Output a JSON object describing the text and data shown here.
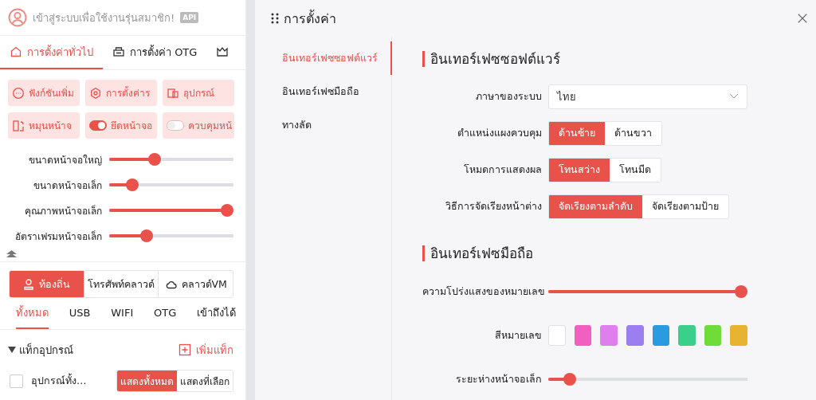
{
  "account": {
    "prompt": "เข้าสู่ระบบเพื่อใช้งานรุ่นสมาชิก!",
    "badge": "API"
  },
  "main_tabs": [
    {
      "label": "การตั้งค่าทั่วไป",
      "selected": true
    },
    {
      "label": "การตั้งค่า OTG",
      "selected": false
    },
    {
      "selected": false
    }
  ],
  "quick_actions": [
    {
      "kind": "button",
      "label": "ฟังก์ชันเพิ่ม"
    },
    {
      "kind": "button",
      "label": "การตั้งค่าร"
    },
    {
      "kind": "button",
      "label": "อุปกรณ์"
    },
    {
      "kind": "button",
      "label": "หมุนหน้าจ"
    },
    {
      "kind": "toggle",
      "on": true,
      "label": "ยึดหน้าจอ"
    },
    {
      "kind": "toggle",
      "on": false,
      "label": "ควบคุมหน้"
    }
  ],
  "sliders": [
    {
      "label": "ขนาดหน้าจอใหญ่",
      "level": 0.35
    },
    {
      "label": "ขนาดหน้าจอเล็ก",
      "level": 0.15
    },
    {
      "label": "คุณภาพหน้าจอเล็ก",
      "level": 1
    },
    {
      "label": "อัตราเฟรมหน้าจอเล็ก",
      "level": 0.28
    }
  ],
  "source_switch": [
    {
      "label": "ท้องถิ่น",
      "selected": true
    },
    {
      "label": "โทรศัพท์คลาวด์",
      "selected": false
    },
    {
      "label": "คลาวด์VM",
      "selected": false
    }
  ],
  "filter_tabs": [
    {
      "label": "ทั้งหมด",
      "selected": true
    },
    {
      "label": "USB",
      "selected": false
    },
    {
      "label": "WIFI",
      "selected": false
    },
    {
      "label": "OTG",
      "selected": false
    },
    {
      "label": "เข้าถึงได้",
      "selected": false
    }
  ],
  "tags": {
    "title": "แท็กอุปกรณ์",
    "expanded": true,
    "add": "เพิ่มแท็ก"
  },
  "device_row": {
    "checked": false,
    "label": "อุปกรณ์ทั้ง…",
    "options": [
      {
        "label": "แสดงทั้งหมด",
        "selected": true
      },
      {
        "label": "แสดงที่เลือก",
        "selected": false
      }
    ]
  },
  "settings": {
    "title": "การตั้งค่า",
    "nav": [
      {
        "label": "อินเทอร์เฟซซอฟต์แวร์",
        "selected": true
      },
      {
        "label": "อินเทอร์เฟซมือถือ",
        "selected": false
      },
      {
        "label": "ทางลัด",
        "selected": false
      }
    ],
    "sections": [
      {
        "title": "อินเทอร์เฟซซอฟต์แวร์",
        "rows": [
          {
            "kind": "select",
            "label": "ภาษาของระบบ",
            "value": "ไทย"
          },
          {
            "kind": "segmented",
            "label": "ตำแหน่งแผงควบคุม",
            "options": [
              {
                "label": "ด้านซ้าย",
                "selected": true
              },
              {
                "label": "ด้านขวา",
                "selected": false
              }
            ]
          },
          {
            "kind": "segmented",
            "label": "โหมดการแสดงผล",
            "options": [
              {
                "label": "โทนสว่าง",
                "selected": true
              },
              {
                "label": "โทนมืด",
                "selected": false
              }
            ]
          },
          {
            "kind": "segmented",
            "label": "วิธีการจัดเรียงหน้าต่าง",
            "options": [
              {
                "label": "จัดเรียงตามลำดับ",
                "selected": true
              },
              {
                "label": "จัดเรียงตามป้าย",
                "selected": false
              }
            ]
          }
        ]
      },
      {
        "title": "อินเทอร์เฟซมือถือ",
        "rows": [
          {
            "kind": "slider",
            "label": "ความโปร่งแสงของหมายเลข",
            "level": 1
          },
          {
            "kind": "colors",
            "label": "สีหมายเลข",
            "colors": [
              {
                "color": "#ffffff"
              },
              {
                "color": "#f25fbf"
              },
              {
                "color": "#e07ef0"
              },
              {
                "color": "#9b7ff0"
              },
              {
                "color": "#2b9be0"
              },
              {
                "color": "#3ccf8a"
              },
              {
                "color": "#6fdc3a"
              },
              {
                "color": "#e6b431"
              }
            ]
          },
          {
            "kind": "slider",
            "label": "ระยะห่างหน้าจอเล็ก",
            "level": 0.08
          }
        ]
      }
    ]
  }
}
